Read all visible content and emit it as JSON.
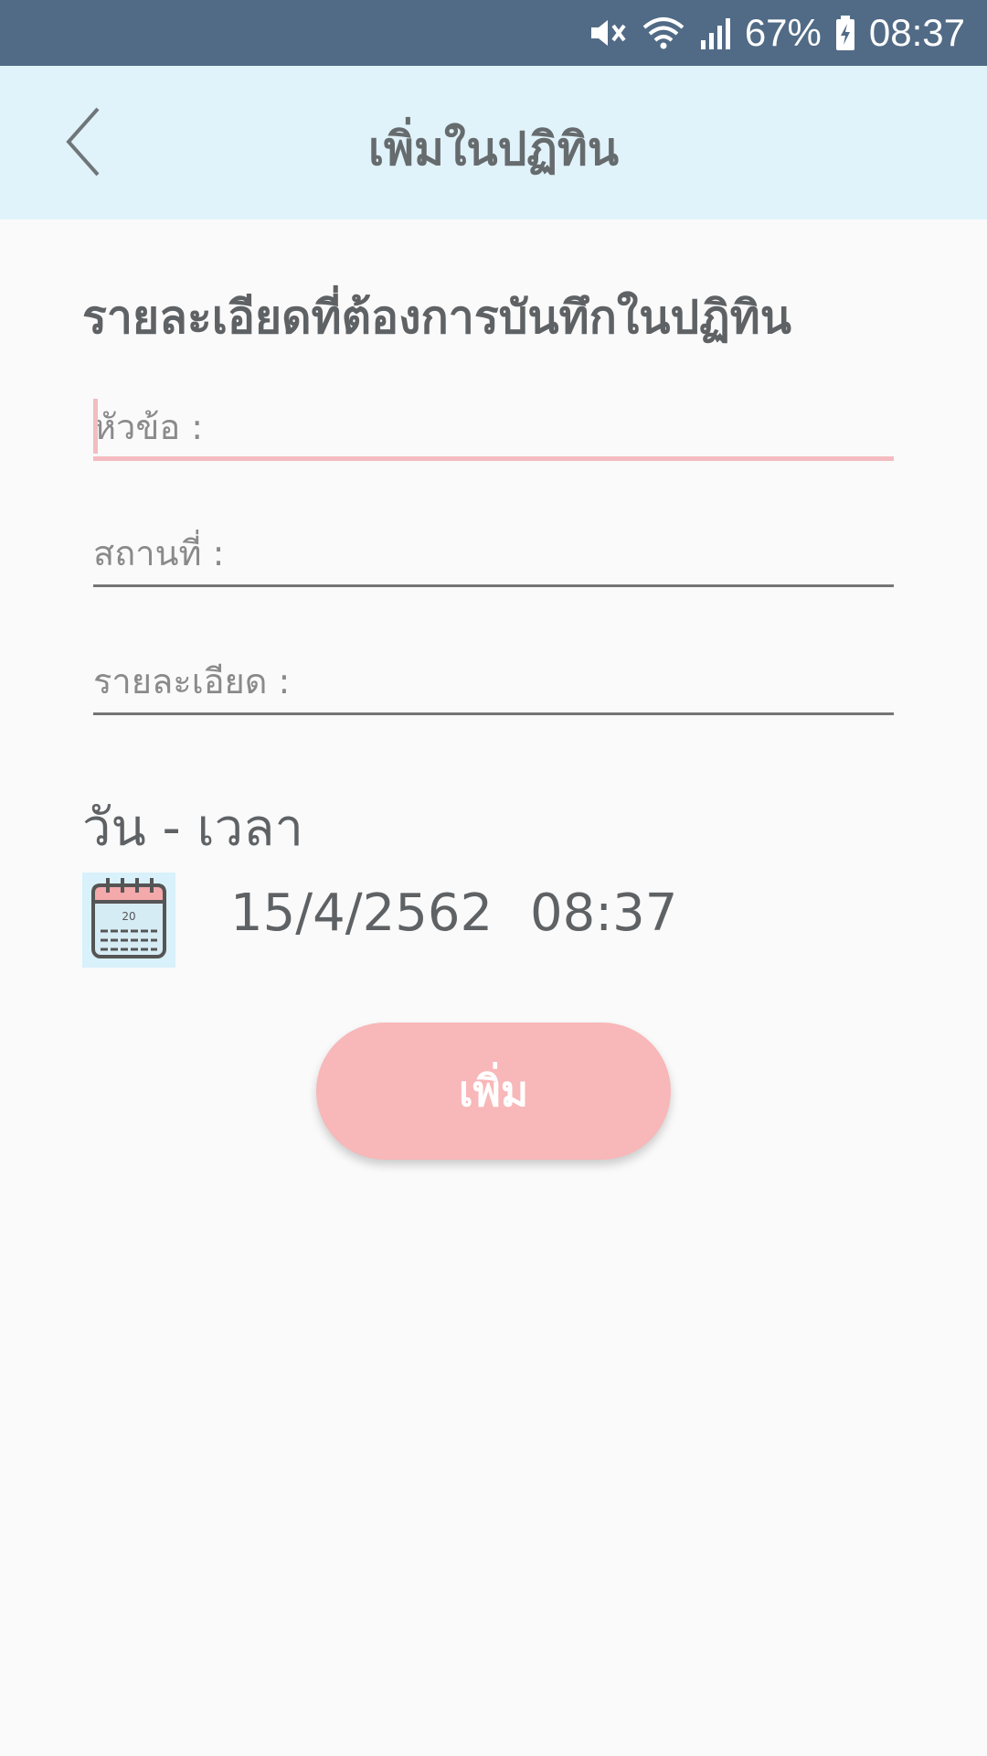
{
  "status_bar": {
    "battery": "67%",
    "time": "08:37",
    "icons": [
      "mute-icon",
      "wifi-icon",
      "signal-icon",
      "battery-charging-icon"
    ]
  },
  "app_bar": {
    "title": "เพิ่มในปฏิทิน",
    "back_icon": "chevron-left-icon"
  },
  "form": {
    "section_title": "รายละเอียดที่ต้องการบันทึกในปฏิทิน",
    "fields": [
      {
        "placeholder": "หัวข้อ :",
        "value": ""
      },
      {
        "placeholder": "สถานที่ :",
        "value": ""
      },
      {
        "placeholder": "รายละเอียด :",
        "value": ""
      }
    ],
    "datetime_heading": "วัน - เวลา",
    "date": "15/4/2562",
    "time": "08:37",
    "calendar_icon": "calendar-icon",
    "add_label": "เพิ่ม"
  },
  "colors": {
    "status_bar": "#516b86",
    "app_bar": "#e1f3fa",
    "accent_pink": "#f8b7b8",
    "text_dark": "#5f6265"
  }
}
